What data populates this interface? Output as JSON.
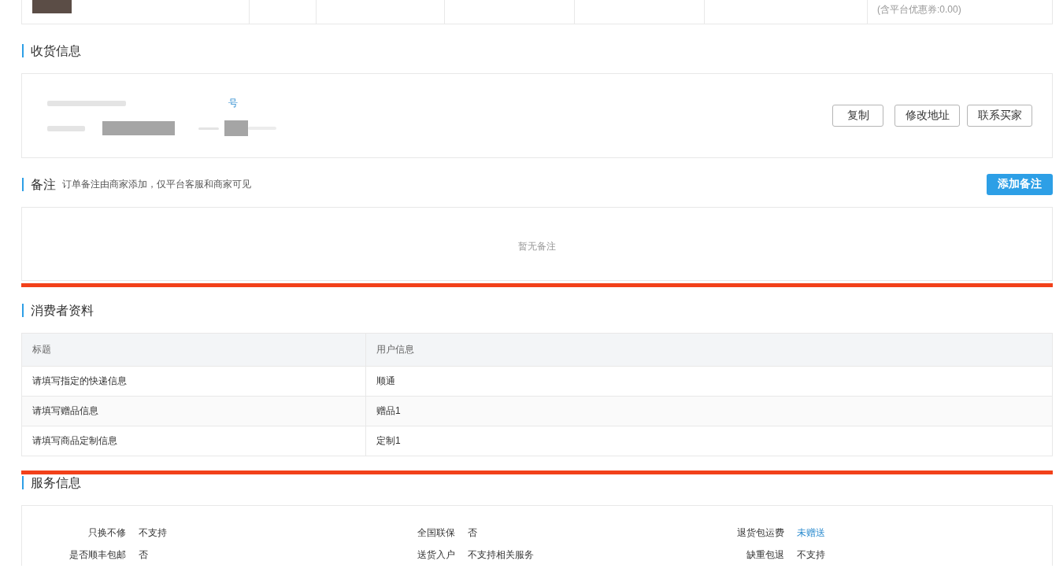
{
  "product_row": {
    "coupon_note": "(含平台优惠券:0.00)"
  },
  "shipping": {
    "title": "收货信息",
    "link_fragment": "号",
    "buttons": [
      "复制",
      "修改地址",
      "联系买家"
    ]
  },
  "remarks": {
    "title": "备注",
    "hint": "订单备注由商家添加，仅平台客服和商家可见",
    "add_button": "添加备注",
    "empty_text": "暂无备注"
  },
  "consumer_info": {
    "title": "消费者资料",
    "highlighted": true,
    "columns": [
      "标题",
      "用户信息"
    ],
    "rows": [
      [
        "请填写指定的快递信息",
        "顺通"
      ],
      [
        "请填写赠品信息",
        "赠品1"
      ],
      [
        "请填写商品定制信息",
        "定制1"
      ]
    ]
  },
  "service_info": {
    "title": "服务信息",
    "items": [
      {
        "label": "只换不修",
        "value": "不支持",
        "kind": "text"
      },
      {
        "label": "全国联保",
        "value": "否",
        "kind": "text"
      },
      {
        "label": "退货包运费",
        "value": "未赠送",
        "kind": "link"
      },
      {
        "label": "是否顺丰包邮",
        "value": "否",
        "kind": "text"
      },
      {
        "label": "送货入户",
        "value": "不支持相关服务",
        "kind": "text"
      },
      {
        "label": "缺重包退",
        "value": "不支持",
        "kind": "text"
      }
    ]
  }
}
